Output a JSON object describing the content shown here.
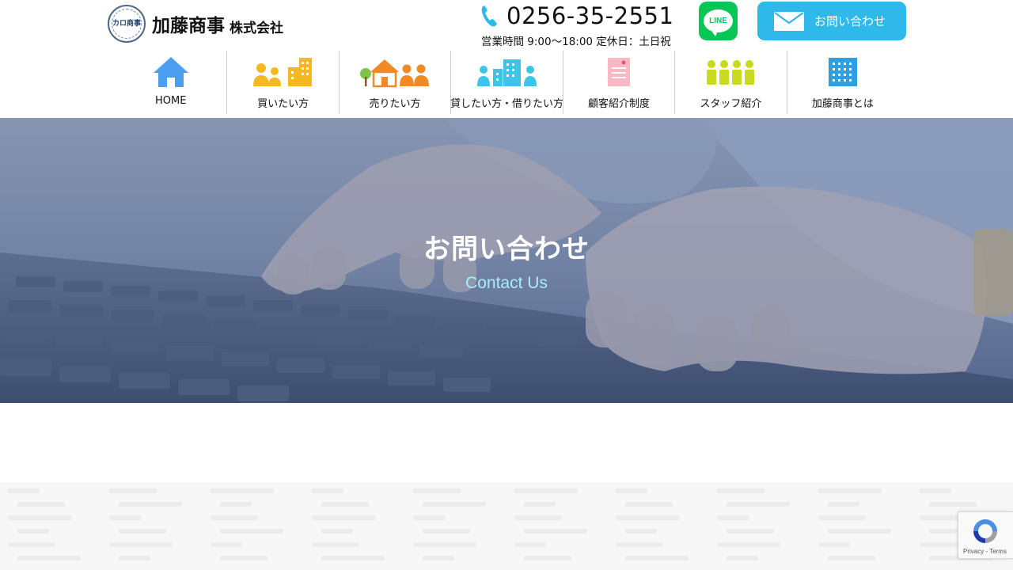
{
  "header": {
    "logo_mark_text": "カロ商事",
    "logo_name": "加藤商事",
    "logo_suffix": "株式会社",
    "tel_icon": "phone-icon",
    "tel_number": "0256-35-2551",
    "hours": "営業時間 9:00〜18:00 定休日：土日祝",
    "line_button": {
      "icon": "line-icon",
      "label": "LINE",
      "color": "#06c755"
    },
    "contact_button": {
      "icon": "mail-icon",
      "label": "お問い合わせ",
      "color": "#2fb8ea"
    }
  },
  "nav": {
    "items": [
      {
        "label": "HOME",
        "icon": "home-icon"
      },
      {
        "label": "買いたい方",
        "icon": "buyers-icon"
      },
      {
        "label": "売りたい方",
        "icon": "sellers-icon"
      },
      {
        "label": "貸したい方・借りたい方",
        "icon": "rental-icon"
      },
      {
        "label": "顧客紹介制度",
        "icon": "referral-document-icon"
      },
      {
        "label": "スタッフ紹介",
        "icon": "staff-icon"
      },
      {
        "label": "加藤商事とは",
        "icon": "company-building-icon"
      }
    ]
  },
  "hero": {
    "title": "お問い合わせ",
    "subtitle": "Contact Us",
    "background": "keyboard-typing-photo"
  },
  "recaptcha": {
    "icon": "recaptcha-icon",
    "text": "Privacy - Terms"
  },
  "colors": {
    "accent": "#2fb8ea",
    "line_green": "#06c755",
    "hero_overlay": "#3c558c",
    "subtitle": "#a9ecff"
  }
}
